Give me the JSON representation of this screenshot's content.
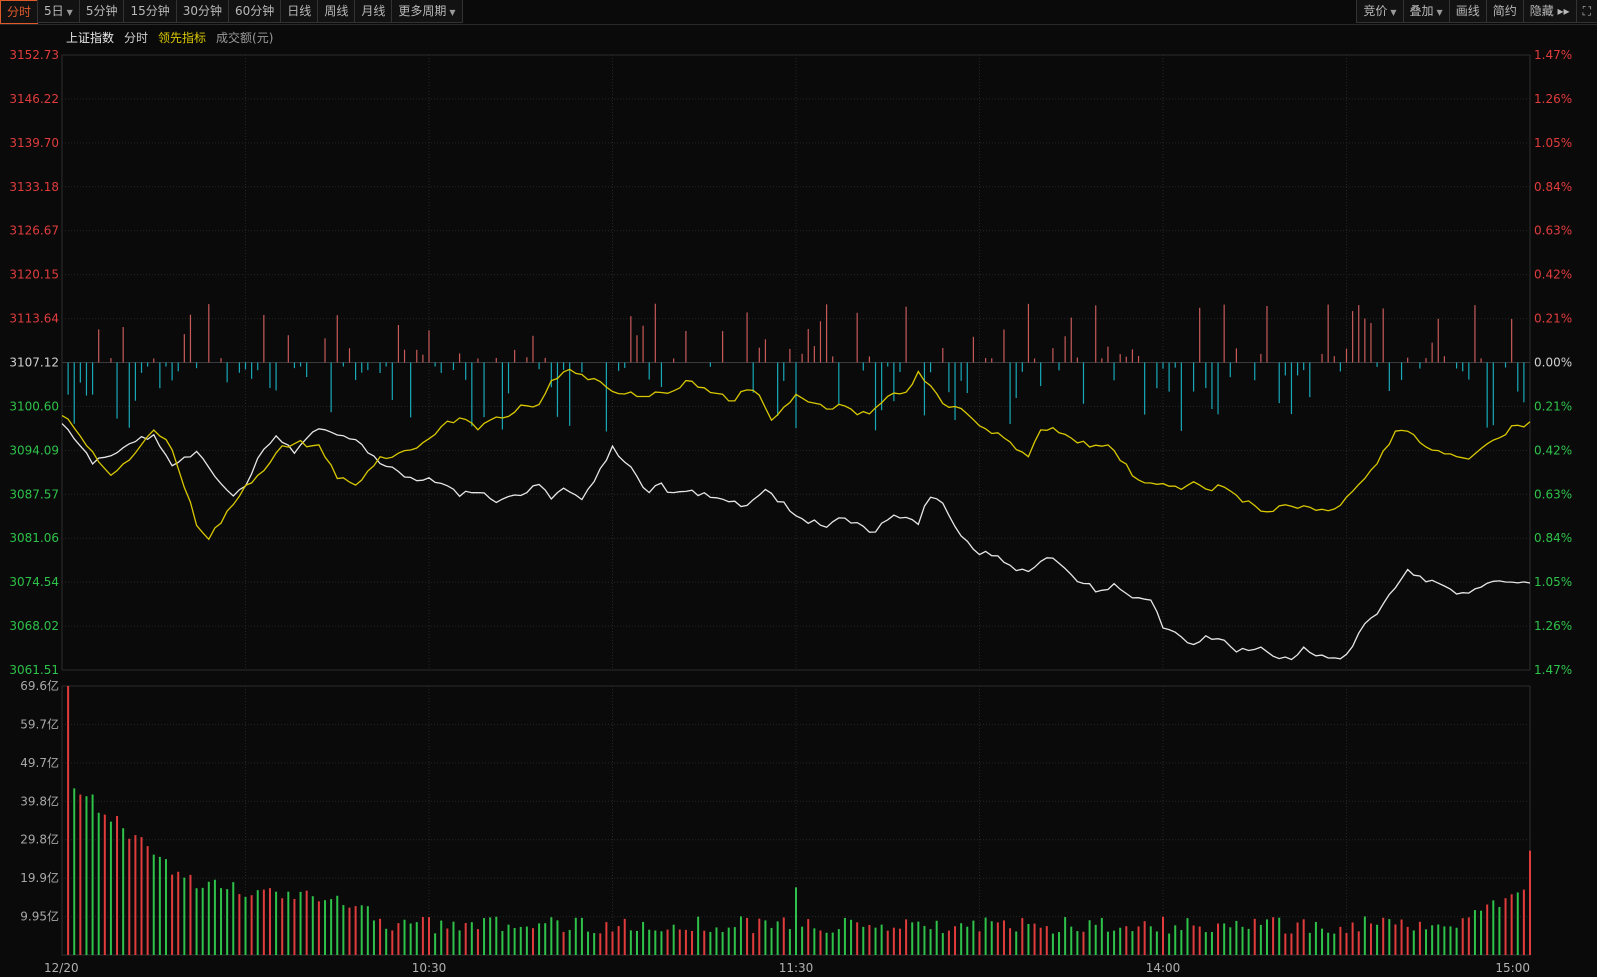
{
  "toolbar": {
    "left": [
      {
        "label": "分时",
        "active": true,
        "caret": false
      },
      {
        "label": "5日",
        "active": false,
        "caret": true
      },
      {
        "label": "5分钟",
        "active": false,
        "caret": false
      },
      {
        "label": "15分钟",
        "active": false,
        "caret": false
      },
      {
        "label": "30分钟",
        "active": false,
        "caret": false
      },
      {
        "label": "60分钟",
        "active": false,
        "caret": false
      },
      {
        "label": "日线",
        "active": false,
        "caret": false
      },
      {
        "label": "周线",
        "active": false,
        "caret": false
      },
      {
        "label": "月线",
        "active": false,
        "caret": false
      },
      {
        "label": "更多周期",
        "active": false,
        "caret": true
      }
    ],
    "right": [
      {
        "label": "竞价",
        "caret": true
      },
      {
        "label": "叠加",
        "caret": true
      },
      {
        "label": "画线",
        "caret": false
      },
      {
        "label": "简约",
        "caret": false
      },
      {
        "label": "隐藏 ▸▸",
        "caret": false
      }
    ]
  },
  "legend": {
    "index_name": "上证指数",
    "mode": "分时",
    "lead_indicator": "领先指标",
    "amount": "成交额(元)"
  },
  "colors": {
    "up": "#e03c3c",
    "down": "#2ec24a",
    "bar_up": "#c85a5a",
    "bar_down": "#18a8b8",
    "index_line": "#e6e6e6",
    "lead_line": "#d8c800",
    "grid": "#262626"
  },
  "chart_data": {
    "type": "line",
    "price_axis": {
      "prev_close": 3107.12,
      "ylim": [
        3061.51,
        3152.73
      ],
      "left_ticks": [
        "3152.73",
        "3146.22",
        "3139.70",
        "3133.18",
        "3126.67",
        "3120.15",
        "3113.64",
        "3107.12",
        "3100.60",
        "3094.09",
        "3087.57",
        "3081.06",
        "3074.54",
        "3068.02",
        "3061.51"
      ],
      "right_ticks": [
        "1.47%",
        "1.26%",
        "1.05%",
        "0.84%",
        "0.63%",
        "0.42%",
        "0.21%",
        "0.00%",
        "0.21%",
        "0.42%",
        "0.63%",
        "0.84%",
        "1.05%",
        "1.26%",
        "1.47%"
      ]
    },
    "volume_axis": {
      "ylim": [
        0,
        69.6
      ],
      "ticks": [
        "69.6亿",
        "59.7亿",
        "49.7亿",
        "39.8亿",
        "29.8亿",
        "19.9亿",
        "9.95亿"
      ]
    },
    "x_labels": [
      "12/20",
      "10:30",
      "11:30",
      "14:00",
      "15:00"
    ],
    "minutes": 240,
    "series": [
      {
        "key": "index",
        "points": [
          [
            0,
            3098.5
          ],
          [
            5,
            3092
          ],
          [
            10,
            3094.5
          ],
          [
            15,
            3096.5
          ],
          [
            18,
            3091.5
          ],
          [
            22,
            3094
          ],
          [
            25,
            3090
          ],
          [
            28,
            3087
          ],
          [
            30,
            3089
          ],
          [
            32,
            3093
          ],
          [
            35,
            3096
          ],
          [
            38,
            3094
          ],
          [
            42,
            3097.5
          ],
          [
            45,
            3096
          ],
          [
            48,
            3095.5
          ],
          [
            52,
            3092
          ],
          [
            55,
            3091
          ],
          [
            58,
            3089.5
          ],
          [
            60,
            3090
          ],
          [
            62,
            3089
          ],
          [
            65,
            3087.5
          ],
          [
            68,
            3088
          ],
          [
            70,
            3087
          ],
          [
            72,
            3086.5
          ],
          [
            75,
            3087.5
          ],
          [
            78,
            3089
          ],
          [
            80,
            3087
          ],
          [
            82,
            3088.5
          ],
          [
            85,
            3086.5
          ],
          [
            88,
            3091
          ],
          [
            90,
            3094.5
          ],
          [
            92,
            3092.5
          ],
          [
            94,
            3090
          ],
          [
            96,
            3088
          ],
          [
            98,
            3089
          ],
          [
            100,
            3087.5
          ],
          [
            102,
            3088
          ],
          [
            105,
            3087.5
          ],
          [
            108,
            3087
          ],
          [
            110,
            3086.5
          ],
          [
            112,
            3085.5
          ],
          [
            115,
            3088
          ],
          [
            118,
            3086
          ],
          [
            120,
            3084
          ],
          [
            122,
            3083.5
          ],
          [
            125,
            3083
          ],
          [
            128,
            3084
          ],
          [
            130,
            3083
          ],
          [
            133,
            3082
          ],
          [
            135,
            3084
          ],
          [
            138,
            3084.5
          ],
          [
            140,
            3083.5
          ],
          [
            142,
            3087.5
          ],
          [
            144,
            3086
          ],
          [
            146,
            3083
          ],
          [
            148,
            3080.5
          ],
          [
            150,
            3079
          ],
          [
            152,
            3078.5
          ],
          [
            155,
            3077
          ],
          [
            158,
            3076
          ],
          [
            160,
            3077.5
          ],
          [
            162,
            3078
          ],
          [
            165,
            3075.5
          ],
          [
            168,
            3074
          ],
          [
            170,
            3073
          ],
          [
            172,
            3074
          ],
          [
            175,
            3072
          ],
          [
            178,
            3071.5
          ],
          [
            180,
            3068
          ],
          [
            183,
            3066
          ],
          [
            185,
            3065.5
          ],
          [
            188,
            3066.5
          ],
          [
            190,
            3065.5
          ],
          [
            192,
            3064.5
          ],
          [
            195,
            3065
          ],
          [
            198,
            3063.5
          ],
          [
            200,
            3063
          ],
          [
            203,
            3064.5
          ],
          [
            205,
            3063.5
          ],
          [
            208,
            3063
          ],
          [
            210,
            3064
          ],
          [
            213,
            3068
          ],
          [
            215,
            3070
          ],
          [
            218,
            3073.5
          ],
          [
            220,
            3076
          ],
          [
            223,
            3075
          ],
          [
            225,
            3074.5
          ],
          [
            228,
            3073
          ],
          [
            230,
            3073
          ],
          [
            232,
            3074
          ],
          [
            235,
            3075
          ],
          [
            238,
            3074.5
          ],
          [
            240,
            3074.5
          ]
        ]
      },
      {
        "key": "lead",
        "points": [
          [
            0,
            3099.5
          ],
          [
            5,
            3093.5
          ],
          [
            8,
            3090
          ],
          [
            12,
            3094
          ],
          [
            15,
            3097
          ],
          [
            18,
            3094.5
          ],
          [
            20,
            3089
          ],
          [
            22,
            3083
          ],
          [
            24,
            3081
          ],
          [
            27,
            3085
          ],
          [
            30,
            3088.5
          ],
          [
            33,
            3091
          ],
          [
            35,
            3094
          ],
          [
            38,
            3095.5
          ],
          [
            42,
            3094.5
          ],
          [
            45,
            3090
          ],
          [
            48,
            3089
          ],
          [
            52,
            3093
          ],
          [
            55,
            3093.5
          ],
          [
            58,
            3094.5
          ],
          [
            62,
            3097.5
          ],
          [
            65,
            3099
          ],
          [
            68,
            3097.5
          ],
          [
            72,
            3099
          ],
          [
            75,
            3100.5
          ],
          [
            78,
            3101
          ],
          [
            80,
            3104
          ],
          [
            82,
            3106
          ],
          [
            85,
            3105
          ],
          [
            88,
            3104
          ],
          [
            90,
            3103
          ],
          [
            92,
            3102.5
          ],
          [
            95,
            3102
          ],
          [
            98,
            3103
          ],
          [
            100,
            3102.5
          ],
          [
            102,
            3104.5
          ],
          [
            105,
            3103
          ],
          [
            108,
            3102
          ],
          [
            110,
            3101.5
          ],
          [
            112,
            3103.5
          ],
          [
            114,
            3102
          ],
          [
            116,
            3099
          ],
          [
            118,
            3100.5
          ],
          [
            120,
            3102
          ],
          [
            122,
            3101.5
          ],
          [
            125,
            3100
          ],
          [
            128,
            3101
          ],
          [
            130,
            3099.5
          ],
          [
            133,
            3100
          ],
          [
            135,
            3102
          ],
          [
            138,
            3103
          ],
          [
            140,
            3105.5
          ],
          [
            142,
            3104
          ],
          [
            144,
            3101
          ],
          [
            146,
            3100.5
          ],
          [
            148,
            3099.5
          ],
          [
            150,
            3098
          ],
          [
            152,
            3097
          ],
          [
            155,
            3095
          ],
          [
            158,
            3093.5
          ],
          [
            160,
            3097.5
          ],
          [
            162,
            3097.5
          ],
          [
            165,
            3095.5
          ],
          [
            168,
            3095
          ],
          [
            170,
            3095
          ],
          [
            172,
            3094
          ],
          [
            175,
            3090.5
          ],
          [
            178,
            3089
          ],
          [
            180,
            3089.5
          ],
          [
            183,
            3088
          ],
          [
            185,
            3089
          ],
          [
            188,
            3088.5
          ],
          [
            190,
            3089
          ],
          [
            192,
            3087.5
          ],
          [
            195,
            3085.5
          ],
          [
            198,
            3085
          ],
          [
            200,
            3086
          ],
          [
            203,
            3085.5
          ],
          [
            205,
            3085
          ],
          [
            208,
            3085.5
          ],
          [
            210,
            3087
          ],
          [
            213,
            3090
          ],
          [
            215,
            3092.5
          ],
          [
            218,
            3096.5
          ],
          [
            220,
            3097
          ],
          [
            223,
            3095
          ],
          [
            225,
            3094
          ],
          [
            228,
            3093
          ],
          [
            230,
            3092.5
          ],
          [
            232,
            3094.5
          ],
          [
            235,
            3096
          ],
          [
            238,
            3098
          ],
          [
            240,
            3098
          ]
        ]
      }
    ]
  }
}
